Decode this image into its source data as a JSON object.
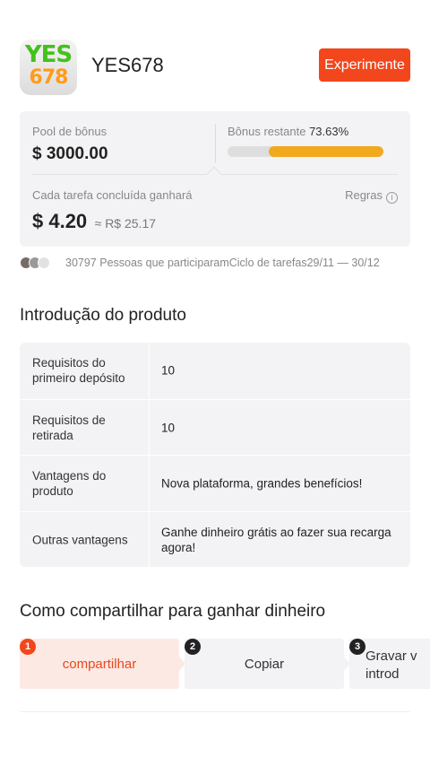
{
  "app": {
    "logo_line1": "YES",
    "logo_line2": "678",
    "name": "YES678",
    "try_label": "Experimente"
  },
  "pool": {
    "label": "Pool de bônus",
    "value": "$ 3000.00",
    "remaining_label": "Bônus restante",
    "remaining_pct": "73.63%",
    "remaining_fraction": 0.7363,
    "task_label": "Cada tarefa concluída ganhará",
    "rules_label": "Regras",
    "reward_usd": "$ 4.20",
    "reward_brl": "≈ R$ 25.17"
  },
  "participants": {
    "text": "30797 Pessoas que participaramCiclo de tarefas29/11 — 30/12"
  },
  "intro": {
    "title": "Introdução do produto",
    "rows": [
      {
        "key": "Requisitos do primeiro depósito",
        "value": "10"
      },
      {
        "key": "Requisitos de retirada",
        "value": "10"
      },
      {
        "key": "Vantagens do produto",
        "value": "Nova plataforma, grandes benefícios!"
      },
      {
        "key": "Outras vantagens",
        "value": "Ganhe dinheiro grátis ao fazer sua recarga agora!"
      }
    ]
  },
  "share": {
    "title": "Como compartilhar para ganhar dinheiro",
    "steps": [
      {
        "num": "1",
        "label": "compartilhar"
      },
      {
        "num": "2",
        "label": "Copiar"
      },
      {
        "num": "3",
        "label": "Gravar v introd"
      }
    ]
  },
  "colors": {
    "accent": "#f2461d",
    "progress": "#f2a91e",
    "card_bg": "#f3f3f5"
  }
}
